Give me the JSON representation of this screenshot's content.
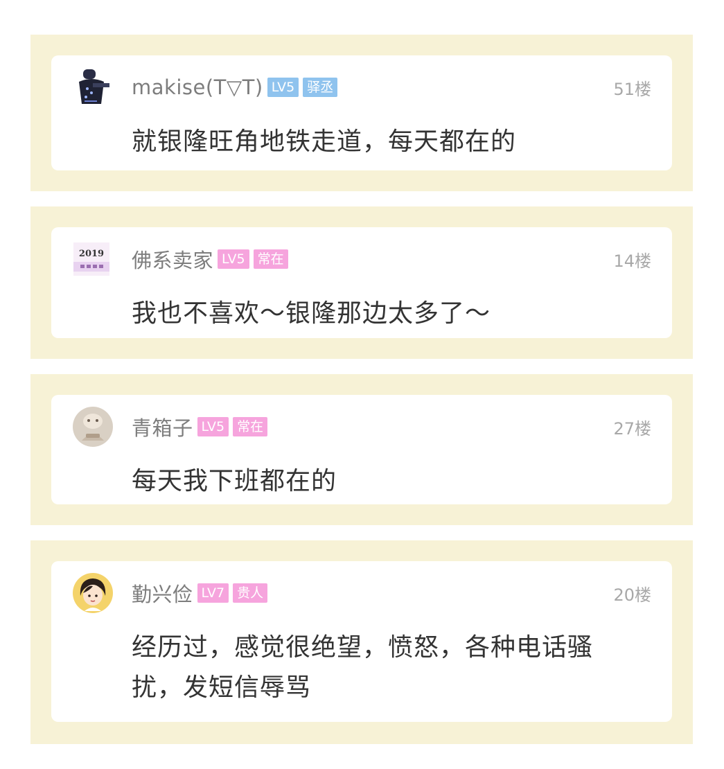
{
  "colors": {
    "panel_bg": "#f7f2d6",
    "card_bg": "#ffffff",
    "badge_blue": "#8fc3ee",
    "badge_pink": "#f6a4dd",
    "name_text": "#7d7d7d",
    "floor_text": "#a8a8a8",
    "content_text": "#333333"
  },
  "comments": [
    {
      "avatar_icon": "figure-avatar-icon",
      "username": "makise(T▽T)",
      "level": "LV5",
      "title": "驿丞",
      "badge_color": "#8fc3ee",
      "floor": "51楼",
      "text": "就银隆旺角地铁走道，每天都在的"
    },
    {
      "avatar_icon": "calendar-2019-avatar-icon",
      "avatar_text": "2019",
      "username": "佛系卖家",
      "level": "LV5",
      "title": "常在",
      "badge_color": "#f6a4dd",
      "floor": "14楼",
      "text": "我也不喜欢～银隆那边太多了～"
    },
    {
      "avatar_icon": "round-photo-avatar-icon",
      "username": "青箱子",
      "level": "LV5",
      "title": "常在",
      "badge_color": "#f6a4dd",
      "floor": "27楼",
      "text": "每天我下班都在的"
    },
    {
      "avatar_icon": "cartoon-girl-avatar-icon",
      "username": "勤兴俭",
      "level": "LV7",
      "title": "贵人",
      "badge_color": "#f6a4dd",
      "floor": "20楼",
      "text": "经历过，感觉很绝望，愤怒，各种电话骚扰，发短信辱骂"
    }
  ]
}
